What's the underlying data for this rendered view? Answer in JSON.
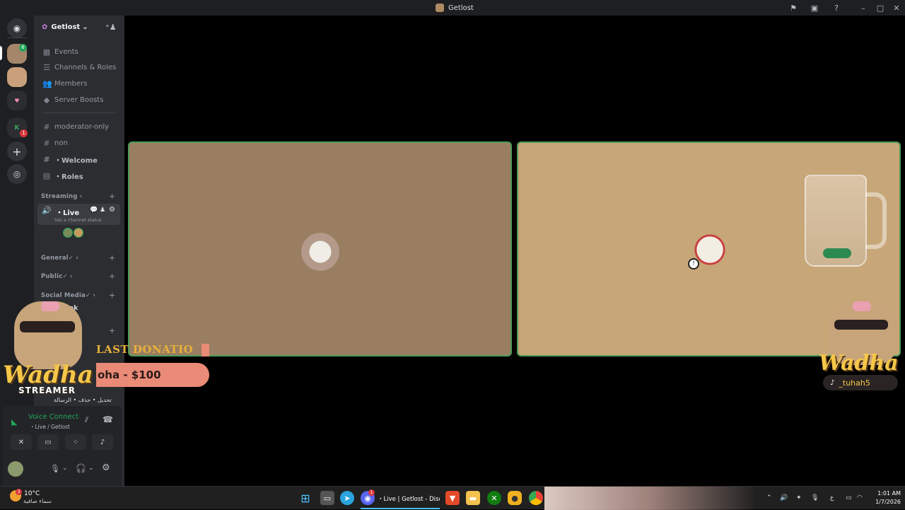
{
  "window": {
    "title": "Getlost"
  },
  "server": {
    "name": "Getlost",
    "menu": [
      "Events",
      "Channels & Roles",
      "Members",
      "Server Boosts"
    ],
    "channels": [
      "moderator-only",
      "non",
      "・Welcome",
      "・Roles"
    ],
    "categories": {
      "streaming": "Streaming",
      "general": "General✓",
      "public": "Public✓",
      "social": "Social Media✓"
    },
    "live_channel": {
      "name": "・Live",
      "status_placeholder": "Set a channel status"
    },
    "partial_channel_label": "eak",
    "arabic_channel": "تحديل • حذف • الرسالة"
  },
  "rail": {
    "badge_green": "6",
    "badge_red": "1"
  },
  "voice": {
    "status": "Voice Connecte",
    "location": "・Live / Getlost"
  },
  "overlay": {
    "last_donation_label": "LAST DONATIO",
    "donation_value": "oha - $100",
    "brand_left": "Wadha",
    "brand_left_sub": "STREAMER",
    "brand_right": "Wadha",
    "tiktok_handle": "_tuhah5"
  },
  "taskbar": {
    "weather_temp": "10°C",
    "weather_text": "سماء صافية",
    "weather_badge": "3",
    "discord_task": "・Live | Getlost - Discorc",
    "discord_badge": "1",
    "lang": "ع",
    "time": "1:01 AM",
    "date": "1/7/2026"
  },
  "colors": {
    "accent_green": "#23a55a",
    "tile_border": "#4e9c5a",
    "tile_left": "#9a7e61",
    "tile_right": "#c7a678",
    "donation_gold": "#e8b13b",
    "donation_pill": "#e98b76"
  }
}
